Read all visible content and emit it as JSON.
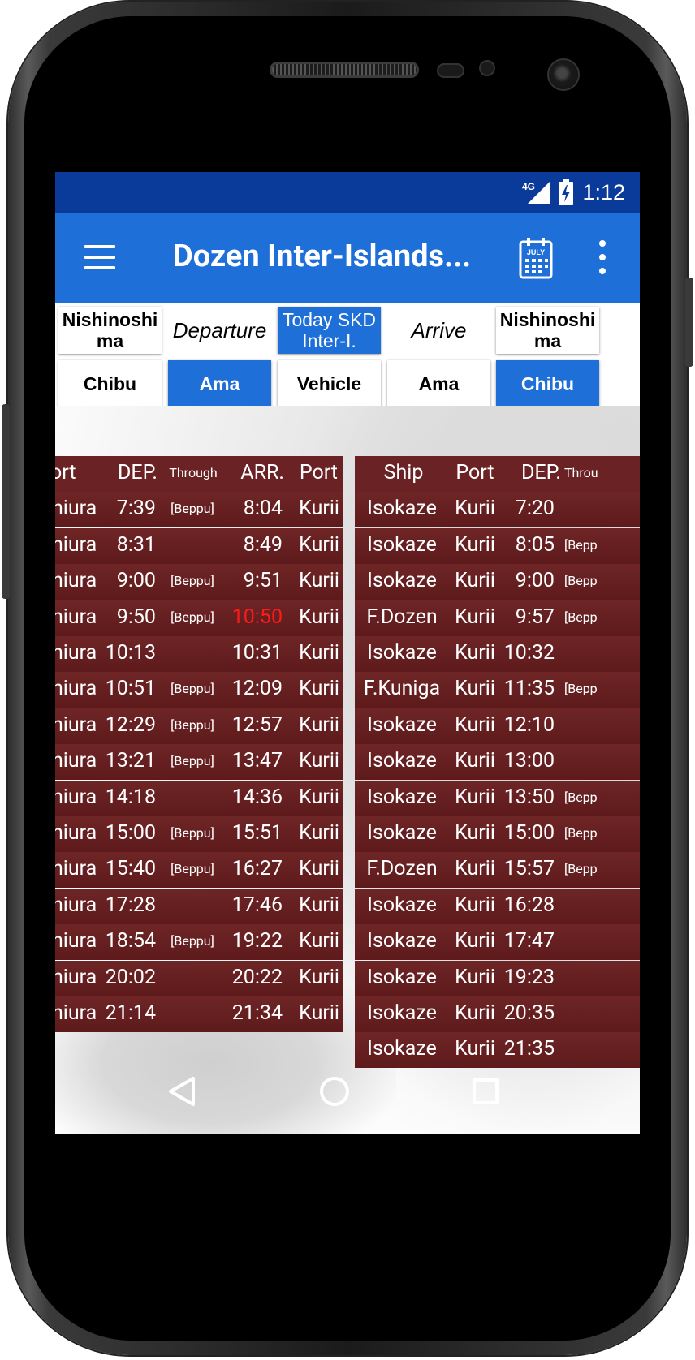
{
  "status": {
    "network": "4G",
    "time": "1:12"
  },
  "appbar": {
    "title": "Dozen Inter-Islands...",
    "calendar_label": "JULY"
  },
  "selector": {
    "row1": [
      "Nishinoshi\nma",
      "Departure",
      "Today SKD\nInter-I.",
      "Arrive",
      "Nishinoshi\nma"
    ],
    "row2": [
      "Chibu",
      "Ama",
      "Vehicle",
      "Ama",
      "Chibu"
    ]
  },
  "left_table": {
    "headers": [
      "ort",
      "DEP.",
      "Through",
      "ARR.",
      "Port"
    ],
    "rows": [
      {
        "port": "hiura",
        "dep": "7:39",
        "through": "[Beppu]",
        "arr": "8:04",
        "dest": "Kurii",
        "arr_red": false
      },
      {
        "port": "hiura",
        "dep": "8:31",
        "through": "",
        "arr": "8:49",
        "dest": "Kurii",
        "arr_red": false
      },
      {
        "port": "hiura",
        "dep": "9:00",
        "through": "[Beppu]",
        "arr": "9:51",
        "dest": "Kurii",
        "arr_red": false
      },
      {
        "port": "hiura",
        "dep": "9:50",
        "through": "[Beppu]",
        "arr": "10:50",
        "dest": "Kurii",
        "arr_red": true
      },
      {
        "port": "hiura",
        "dep": "10:13",
        "through": "",
        "arr": "10:31",
        "dest": "Kurii",
        "arr_red": false
      },
      {
        "port": "hiura",
        "dep": "10:51",
        "through": "[Beppu]",
        "arr": "12:09",
        "dest": "Kurii",
        "arr_red": false
      },
      {
        "port": "hiura",
        "dep": "12:29",
        "through": "[Beppu]",
        "arr": "12:57",
        "dest": "Kurii",
        "arr_red": false
      },
      {
        "port": "hiura",
        "dep": "13:21",
        "through": "[Beppu]",
        "arr": "13:47",
        "dest": "Kurii",
        "arr_red": false
      },
      {
        "port": "hiura",
        "dep": "14:18",
        "through": "",
        "arr": "14:36",
        "dest": "Kurii",
        "arr_red": false
      },
      {
        "port": "hiura",
        "dep": "15:00",
        "through": "[Beppu]",
        "arr": "15:51",
        "dest": "Kurii",
        "arr_red": false
      },
      {
        "port": "hiura",
        "dep": "15:40",
        "through": "[Beppu]",
        "arr": "16:27",
        "dest": "Kurii",
        "arr_red": false
      },
      {
        "port": "hiura",
        "dep": "17:28",
        "through": "",
        "arr": "17:46",
        "dest": "Kurii",
        "arr_red": false
      },
      {
        "port": "hiura",
        "dep": "18:54",
        "through": "[Beppu]",
        "arr": "19:22",
        "dest": "Kurii",
        "arr_red": false
      },
      {
        "port": "hiura",
        "dep": "20:02",
        "through": "",
        "arr": "20:22",
        "dest": "Kurii",
        "arr_red": false
      },
      {
        "port": "hiura",
        "dep": "21:14",
        "through": "",
        "arr": "21:34",
        "dest": "Kurii",
        "arr_red": false
      }
    ]
  },
  "right_table": {
    "headers": [
      "Ship",
      "Port",
      "DEP.",
      "Throu"
    ],
    "rows": [
      {
        "ship": "Isokaze",
        "port": "Kurii",
        "dep": "7:20",
        "through": ""
      },
      {
        "ship": "Isokaze",
        "port": "Kurii",
        "dep": "8:05",
        "through": "[Bepp"
      },
      {
        "ship": "Isokaze",
        "port": "Kurii",
        "dep": "9:00",
        "through": "[Bepp"
      },
      {
        "ship": "F.Dozen",
        "port": "Kurii",
        "dep": "9:57",
        "through": "[Bepp"
      },
      {
        "ship": "Isokaze",
        "port": "Kurii",
        "dep": "10:32",
        "through": ""
      },
      {
        "ship": "F.Kuniga",
        "port": "Kurii",
        "dep": "11:35",
        "through": "[Bepp"
      },
      {
        "ship": "Isokaze",
        "port": "Kurii",
        "dep": "12:10",
        "through": ""
      },
      {
        "ship": "Isokaze",
        "port": "Kurii",
        "dep": "13:00",
        "through": ""
      },
      {
        "ship": "Isokaze",
        "port": "Kurii",
        "dep": "13:50",
        "through": "[Bepp"
      },
      {
        "ship": "Isokaze",
        "port": "Kurii",
        "dep": "15:00",
        "through": "[Bepp"
      },
      {
        "ship": "F.Dozen",
        "port": "Kurii",
        "dep": "15:57",
        "through": "[Bepp"
      },
      {
        "ship": "Isokaze",
        "port": "Kurii",
        "dep": "16:28",
        "through": ""
      },
      {
        "ship": "Isokaze",
        "port": "Kurii",
        "dep": "17:47",
        "through": ""
      },
      {
        "ship": "Isokaze",
        "port": "Kurii",
        "dep": "19:23",
        "through": ""
      },
      {
        "ship": "Isokaze",
        "port": "Kurii",
        "dep": "20:35",
        "through": ""
      },
      {
        "ship": "Isokaze",
        "port": "Kurii",
        "dep": "21:35",
        "through": ""
      }
    ]
  },
  "navbar": {
    "icons": [
      "back-icon",
      "home-icon",
      "recents-icon"
    ]
  },
  "colors": {
    "appbar": "#1f6fd8",
    "statusbar": "#0a3a9a",
    "row": "#6a1f20",
    "highlight": "#ff1a1a"
  }
}
